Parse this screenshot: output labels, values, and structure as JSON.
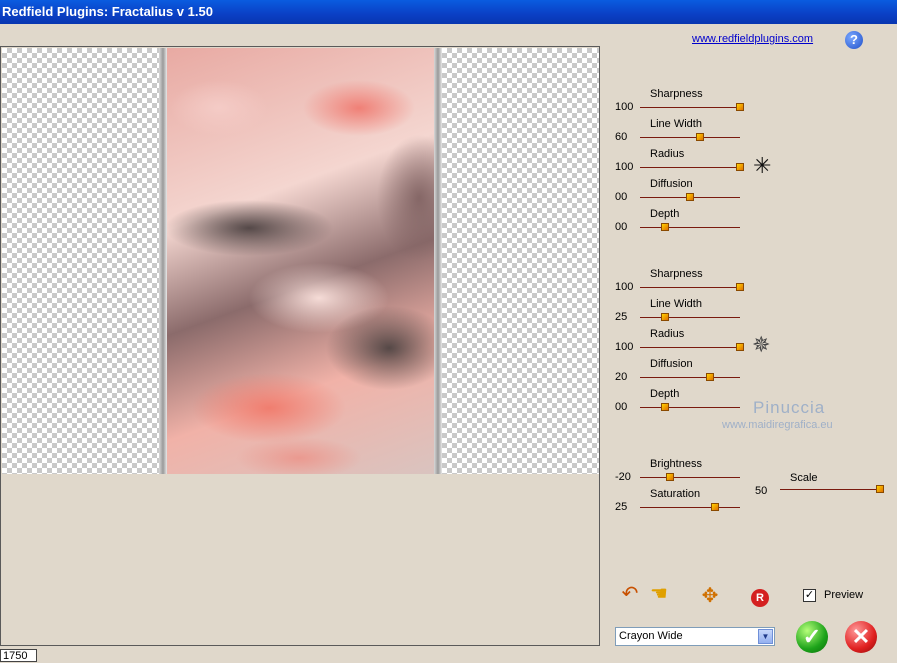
{
  "window": {
    "title": "Redfield Plugins: Fractalius v 1.50"
  },
  "header": {
    "link_text": "www.redfieldplugins.com",
    "help_label": "?"
  },
  "group1": {
    "params": [
      {
        "label": "Sharpness",
        "value": "100",
        "fraction": 1.0
      },
      {
        "label": "Line Width",
        "value": "60",
        "fraction": 0.6
      },
      {
        "label": "Radius",
        "value": "100",
        "fraction": 1.0
      },
      {
        "label": "Diffusion",
        "value": "00",
        "fraction": 0.5
      },
      {
        "label": "Depth",
        "value": "00",
        "fraction": 0.25
      }
    ]
  },
  "group2": {
    "params": [
      {
        "label": "Sharpness",
        "value": "100",
        "fraction": 1.0
      },
      {
        "label": "Line Width",
        "value": "25",
        "fraction": 0.25
      },
      {
        "label": "Radius",
        "value": "100",
        "fraction": 1.0
      },
      {
        "label": "Diffusion",
        "value": "20",
        "fraction": 0.7
      },
      {
        "label": "Depth",
        "value": "00",
        "fraction": 0.25
      }
    ]
  },
  "group3": {
    "params": [
      {
        "label": "Brightness",
        "value": "-20",
        "fraction": 0.3
      },
      {
        "label": "Saturation",
        "value": "25",
        "fraction": 0.75
      }
    ]
  },
  "scale": {
    "label": "Scale",
    "value": "50",
    "fraction": 1.0
  },
  "watermark": {
    "line1": "Pinuccia",
    "line2": "www.maidiregrafica.eu"
  },
  "preview": {
    "label": "Preview",
    "checked": true
  },
  "preset": {
    "selected": "Crayon Wide"
  },
  "zoom": {
    "value": "1750"
  },
  "icons": {
    "star1": "asterisk-icon",
    "star2": "sparkle-icon",
    "undo": "undo-icon",
    "hand": "hand-icon",
    "move": "move-icon",
    "random": "random-icon",
    "ok": "check-icon",
    "cancel": "close-icon"
  }
}
